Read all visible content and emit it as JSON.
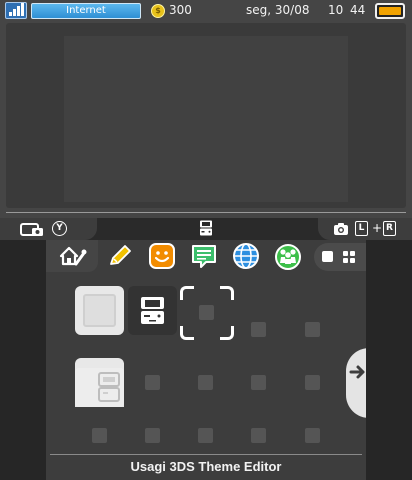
{
  "status_bar": {
    "connection_label": "Internet",
    "coin_symbol": "$",
    "coin_count": "300",
    "date": "seg, 30/08",
    "time_hour": "10",
    "time_minute": "44",
    "battery_color": "#f0a200",
    "signal_icon": "wifi-signal-icon"
  },
  "controls": {
    "left_button_letter": "Y",
    "right_trigger_letter": "L",
    "right_trigger_plus": "+",
    "right_button_letter": "R",
    "left_icon": "screenshot-camera-icon",
    "right_icon": "camera-icon",
    "center_icon": "3ds-icon"
  },
  "app_bar": {
    "icons": [
      {
        "name": "home-settings-icon",
        "color": "#ffffff"
      },
      {
        "name": "pencil-notes-icon",
        "color": "#f2c200"
      },
      {
        "name": "friend-list-icon",
        "color": "#f28c00"
      },
      {
        "name": "notifications-icon",
        "color": "#3dbf6d"
      },
      {
        "name": "internet-browser-icon",
        "color": "#2d8fe0"
      },
      {
        "name": "miiverse-icon",
        "color": "#3dbf4a"
      }
    ],
    "view_toggle": [
      "small-view-icon",
      "grid-view-icon"
    ]
  },
  "grid": {
    "tiles": [
      {
        "name": "blank-app-tile",
        "color": "#e8e8e8"
      },
      {
        "name": "3ds-cartridge-tile",
        "color": "#f0f0f0"
      },
      {
        "name": "folder-tile",
        "color": "#e8e8e8"
      }
    ],
    "scroll_direction_icon": "arrow-right-icon"
  },
  "footer": {
    "title": "Usagi 3DS Theme Editor"
  }
}
